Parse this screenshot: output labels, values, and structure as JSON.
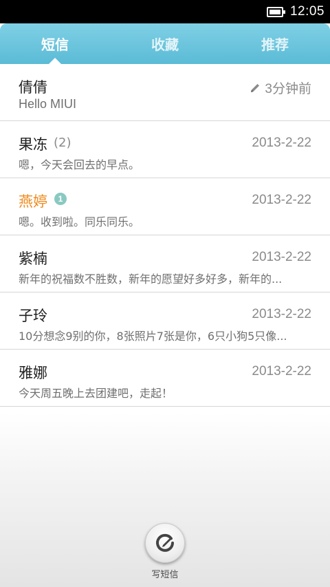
{
  "status_bar": {
    "time": "12:05"
  },
  "tabs": [
    {
      "label": "短信",
      "active": true
    },
    {
      "label": "收藏",
      "active": false
    },
    {
      "label": "推荐",
      "active": false
    }
  ],
  "conversations": [
    {
      "name": "倩倩",
      "time": "3分钟前",
      "preview": "Hello MIUI",
      "draft": true
    },
    {
      "name": "果冻",
      "count": "(2)",
      "time": "2013-2-22",
      "preview": "嗯，今天会回去的早点。"
    },
    {
      "name": "燕婷",
      "badge": "1",
      "time": "2013-2-22",
      "preview": "嗯。收到啦。同乐同乐。",
      "unread": true
    },
    {
      "name": "紫楠",
      "time": "2013-2-22",
      "preview": "新年的祝福数不胜数，新年的愿望好多好多，新年的..."
    },
    {
      "name": "子玲",
      "time": "2013-2-22",
      "preview": "10分想念9别的你，8张照片7张是你，6只小狗5只像..."
    },
    {
      "name": "雅娜",
      "time": "2013-2-22",
      "preview": "今天周五晚上去团建吧，走起！"
    }
  ],
  "compose": {
    "label": "写短信"
  },
  "colors": {
    "tab_bar": "#5bbbd6",
    "unread_name": "#f08a1c",
    "badge": "#8ac9c1"
  }
}
